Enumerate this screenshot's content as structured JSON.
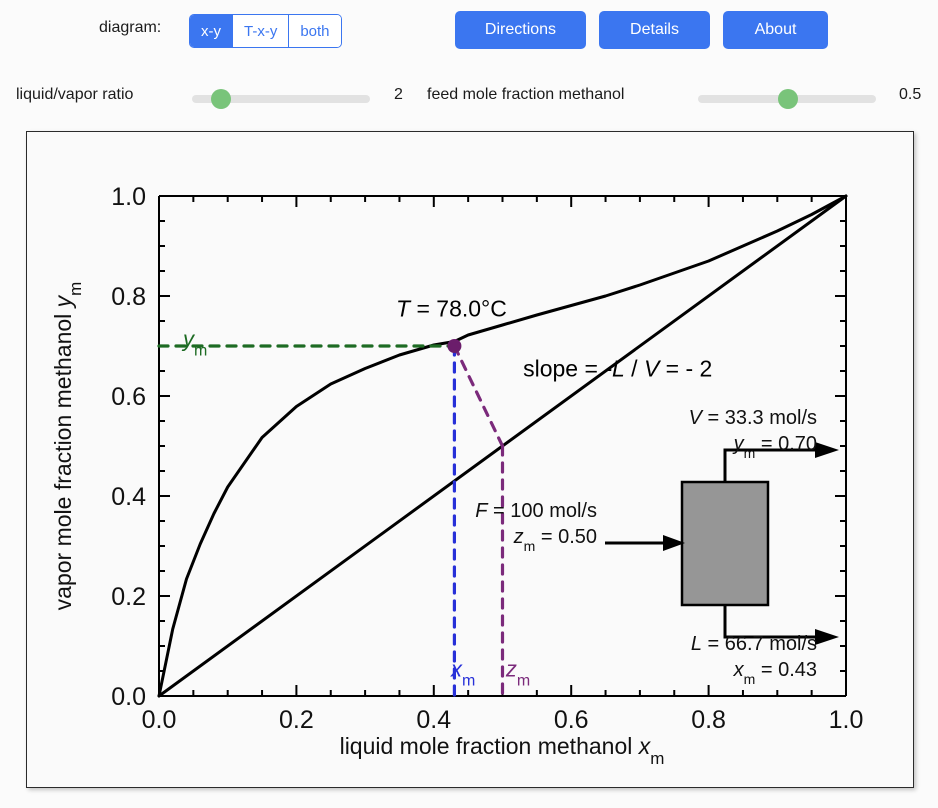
{
  "toolbar": {
    "diagram_label": "diagram:",
    "segments": [
      {
        "label": "x-y",
        "active": true
      },
      {
        "label": "T-x-y",
        "active": false
      },
      {
        "label": "both",
        "active": false
      }
    ],
    "buttons": [
      {
        "label": "Directions"
      },
      {
        "label": "Details"
      },
      {
        "label": "About"
      }
    ],
    "accent_color": "#3b76f0"
  },
  "sliders": [
    {
      "label": "liquid/vapor ratio",
      "value": "2",
      "fill_color": "#79c47a",
      "track_color": "#e2e2e2"
    },
    {
      "label": "feed mole fraction methanol",
      "value": "0.5",
      "fill_color": "#79c47a",
      "track_color": "#e2e2e2"
    }
  ],
  "chart_data": {
    "type": "line",
    "title": "",
    "xlabel": "liquid mole fraction methanol x",
    "xlabel_sub": "m",
    "ylabel": "vapor mole fraction methanol y",
    "ylabel_sub": "m",
    "xlim": [
      0,
      1
    ],
    "ylim": [
      0,
      1
    ],
    "xticks": [
      "0.0",
      "0.2",
      "0.4",
      "0.6",
      "0.8",
      "1.0"
    ],
    "yticks": [
      "0.0",
      "0.2",
      "0.4",
      "0.6",
      "0.8",
      "1.0"
    ],
    "xtick_values": [
      0,
      0.2,
      0.4,
      0.6,
      0.8,
      1.0
    ],
    "ytick_values": [
      0,
      0.2,
      0.4,
      0.6,
      0.8,
      1.0
    ],
    "minor_tick_step": 0.05,
    "grid": false,
    "legend": "none",
    "series": [
      {
        "name": "equilibrium curve methanol-water",
        "color": "#000000",
        "style": "solid",
        "x": [
          0,
          0.02,
          0.04,
          0.06,
          0.08,
          0.1,
          0.15,
          0.2,
          0.25,
          0.3,
          0.35,
          0.4,
          0.43,
          0.45,
          0.5,
          0.55,
          0.6,
          0.65,
          0.7,
          0.75,
          0.8,
          0.85,
          0.9,
          0.95,
          1.0
        ],
        "y": [
          0,
          0.134,
          0.234,
          0.304,
          0.365,
          0.418,
          0.517,
          0.579,
          0.624,
          0.655,
          0.682,
          0.702,
          0.709,
          0.722,
          0.742,
          0.762,
          0.781,
          0.8,
          0.822,
          0.846,
          0.87,
          0.9,
          0.93,
          0.963,
          1.0
        ]
      },
      {
        "name": "45 degree line",
        "color": "#000000",
        "style": "solid",
        "x": [
          0,
          1.0
        ],
        "y": [
          0,
          1.0
        ]
      },
      {
        "name": "operating line slope -L/V",
        "color": "#7b2a7b",
        "style": "dashed",
        "x": [
          0.43,
          0.5
        ],
        "y": [
          0.7,
          0.5
        ]
      },
      {
        "name": "x_m vertical drop line",
        "color": "#2730d8",
        "style": "dashed",
        "x": [
          0.43,
          0.43
        ],
        "y": [
          0.7,
          0.0
        ]
      },
      {
        "name": "z_m vertical line",
        "color": "#7b2a7b",
        "style": "dashed",
        "x": [
          0.5,
          0.5
        ],
        "y": [
          0.5,
          0.0
        ]
      },
      {
        "name": "y_m horizontal line",
        "color": "#1d6b23",
        "style": "dashed",
        "x": [
          0.0,
          0.43
        ],
        "y": [
          0.7,
          0.7
        ]
      }
    ],
    "markers": [
      {
        "name": "operating point",
        "x": 0.43,
        "y": 0.7,
        "color": "#6b1d6b",
        "radius": 7
      }
    ],
    "annotations": [
      {
        "name": "temperature-label",
        "text": "T = 78.0°C",
        "italic_prefix": "T",
        "x": 0.345,
        "y": 0.775,
        "color": "#000000"
      },
      {
        "name": "slope-label",
        "text": "slope = -L / V = - 2",
        "x": 0.53,
        "y": 0.655,
        "color": "#000000"
      },
      {
        "name": "ym-axis-label",
        "text": "y",
        "sub": "m",
        "x": 0.035,
        "y": 0.715,
        "color": "#1d6b23"
      },
      {
        "name": "xm-axis-label",
        "text": "x",
        "sub": "m",
        "x": 0.425,
        "y": 0.055,
        "color": "#2730d8"
      },
      {
        "name": "zm-axis-label",
        "text": "z",
        "sub": "m",
        "x": 0.505,
        "y": 0.055,
        "color": "#7b2a7b"
      }
    ]
  },
  "flash_drum": {
    "name": "flash drum schematic",
    "fill_color": "#969696",
    "stroke_color": "#000000",
    "vapor": {
      "flow_label": "V = 33.3 mol/s",
      "flow_symbol": "V",
      "flow_value": "= 33.3 mol/s",
      "comp_symbol": "y",
      "comp_sub": "m",
      "comp_value": "= 0.70"
    },
    "feed": {
      "flow_label": "F = 100 mol/s",
      "flow_symbol": "F",
      "flow_value": "= 100 mol/s",
      "comp_symbol": "z",
      "comp_sub": "m",
      "comp_value": "= 0.50"
    },
    "liquid": {
      "flow_label": "L = 66.7 mol/s",
      "flow_symbol": "L",
      "flow_value": "= 66.7 mol/s",
      "comp_symbol": "x",
      "comp_sub": "m",
      "comp_value": "= 0.43"
    }
  }
}
